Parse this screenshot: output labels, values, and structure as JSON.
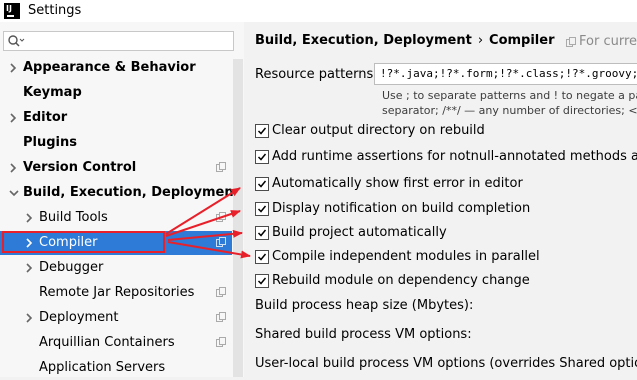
{
  "window": {
    "title": "Settings"
  },
  "sidebar": {
    "search_placeholder": "",
    "items": [
      {
        "label": "Appearance & Behavior",
        "expandable": true
      },
      {
        "label": "Keymap",
        "expandable": false
      },
      {
        "label": "Editor",
        "expandable": true
      },
      {
        "label": "Plugins",
        "expandable": false
      },
      {
        "label": "Version Control",
        "expandable": true
      },
      {
        "label": "Build, Execution, Deployment",
        "expandable": true,
        "expanded": true
      },
      {
        "label": "Build Tools",
        "expandable": true
      },
      {
        "label": "Compiler",
        "expandable": true,
        "selected": true
      },
      {
        "label": "Debugger",
        "expandable": true
      },
      {
        "label": "Remote Jar Repositories",
        "expandable": false
      },
      {
        "label": "Deployment",
        "expandable": true
      },
      {
        "label": "Arquillian Containers",
        "expandable": false
      },
      {
        "label": "Application Servers",
        "expandable": false
      }
    ]
  },
  "main": {
    "breadcrumb": [
      "Build, Execution, Deployment",
      "Compiler"
    ],
    "for_current": "For curren",
    "resource_patterns": {
      "label": "Resource patterns:",
      "value": "!?*.java;!?*.form;!?*.class;!?*.groovy;!?*.",
      "hint_line1": "Use ; to separate patterns and ! to negate a patte",
      "hint_line2": "separator; /**/ — any number of directories; <di"
    },
    "checkboxes": [
      {
        "label": "Clear output directory on rebuild",
        "checked": true
      },
      {
        "label": "Add runtime assertions for notnull-annotated methods and par",
        "checked": true
      },
      {
        "label": "Automatically show first error in editor",
        "checked": true
      },
      {
        "label": "Display notification on build completion",
        "checked": true
      },
      {
        "label": "Build project automatically",
        "checked": true
      },
      {
        "label": "Compile independent modules in parallel",
        "checked": true
      },
      {
        "label": "Rebuild module on dependency change",
        "checked": true
      }
    ],
    "fields": [
      {
        "label": "Build process heap size (Mbytes):"
      },
      {
        "label": "Shared build process VM options:"
      },
      {
        "label": "User-local build process VM options (overrides Shared options):"
      }
    ]
  },
  "colors": {
    "selection": "#2d7bd6",
    "annotation": "#e8202a"
  }
}
